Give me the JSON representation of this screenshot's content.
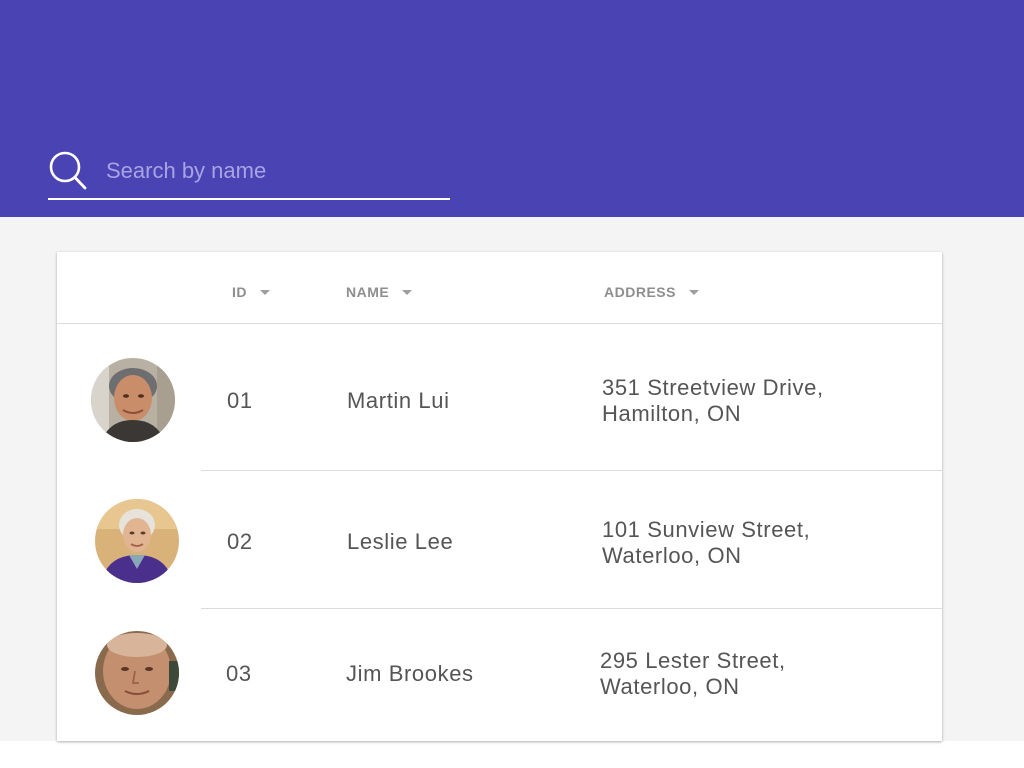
{
  "search": {
    "placeholder": "Search by name",
    "value": ""
  },
  "table": {
    "columns": [
      {
        "label": "ID",
        "sortable": true
      },
      {
        "label": "NAME",
        "sortable": true
      },
      {
        "label": "ADDRESS",
        "sortable": true
      }
    ],
    "rows": [
      {
        "id": "01",
        "name": "Martin Lui",
        "address_line1": "351 Streetview Drive,",
        "address_line2": "Hamilton, ON"
      },
      {
        "id": "02",
        "name": "Leslie Lee",
        "address_line1": "101 Sunview Street,",
        "address_line2": "Waterloo, ON"
      },
      {
        "id": "03",
        "name": "Jim Brookes",
        "address_line1": "295 Lester Street,",
        "address_line2": "Waterloo, ON"
      }
    ]
  },
  "colors": {
    "header_bg": "#4a43b3",
    "page_bg": "#f4f4f4",
    "text": "#555555",
    "column_header": "#8e8e8e"
  },
  "icons": {
    "search": "search-icon",
    "sort": "caret-down-icon"
  }
}
